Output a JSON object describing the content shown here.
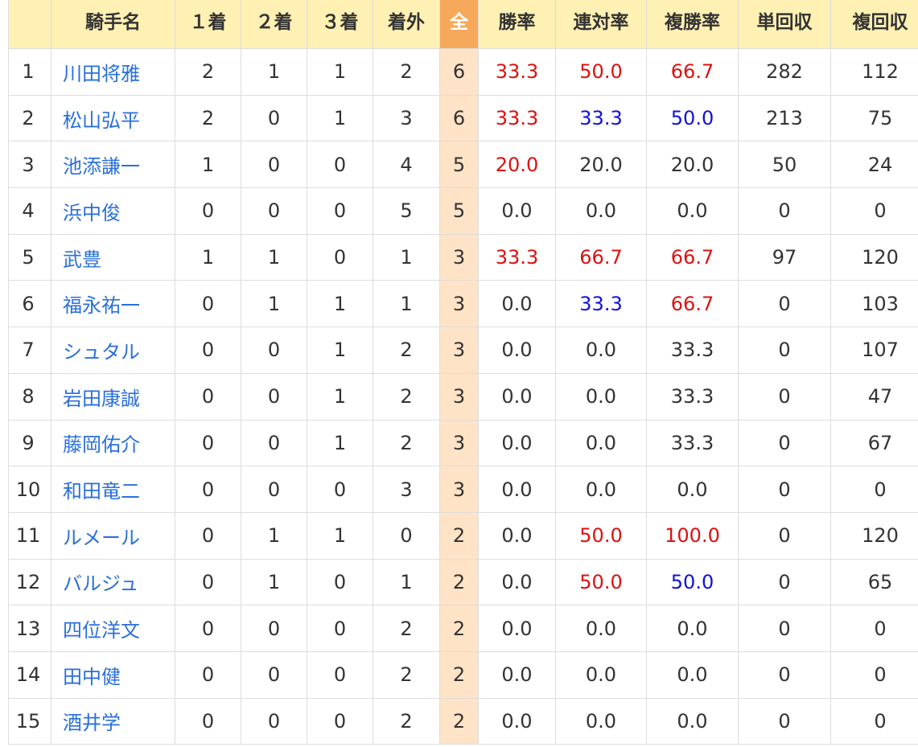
{
  "headers": {
    "blank": "",
    "jockey": "騎手名",
    "first": "１着",
    "second": "２着",
    "third": "３着",
    "out": "着外",
    "total": "全",
    "win_rate": "勝率",
    "quinella_rate": "連対率",
    "place_rate": "複勝率",
    "win_return": "単回収",
    "place_return": "複回収"
  },
  "rows": [
    {
      "rank": "1",
      "name": "川田将雅",
      "first": "2",
      "second": "1",
      "third": "1",
      "out": "2",
      "total": "6",
      "win_rate": "33.3",
      "quinella_rate": "50.0",
      "place_rate": "66.7",
      "win_return": "282",
      "place_return": "112"
    },
    {
      "rank": "2",
      "name": "松山弘平",
      "first": "2",
      "second": "0",
      "third": "1",
      "out": "3",
      "total": "6",
      "win_rate": "33.3",
      "quinella_rate": "33.3",
      "place_rate": "50.0",
      "win_return": "213",
      "place_return": "75"
    },
    {
      "rank": "3",
      "name": "池添謙一",
      "first": "1",
      "second": "0",
      "third": "0",
      "out": "4",
      "total": "5",
      "win_rate": "20.0",
      "quinella_rate": "20.0",
      "place_rate": "20.0",
      "win_return": "50",
      "place_return": "24"
    },
    {
      "rank": "4",
      "name": "浜中俊",
      "first": "0",
      "second": "0",
      "third": "0",
      "out": "5",
      "total": "5",
      "win_rate": "0.0",
      "quinella_rate": "0.0",
      "place_rate": "0.0",
      "win_return": "0",
      "place_return": "0"
    },
    {
      "rank": "5",
      "name": "武豊",
      "first": "1",
      "second": "1",
      "third": "0",
      "out": "1",
      "total": "3",
      "win_rate": "33.3",
      "quinella_rate": "66.7",
      "place_rate": "66.7",
      "win_return": "97",
      "place_return": "120"
    },
    {
      "rank": "6",
      "name": "福永祐一",
      "first": "0",
      "second": "1",
      "third": "1",
      "out": "1",
      "total": "3",
      "win_rate": "0.0",
      "quinella_rate": "33.3",
      "place_rate": "66.7",
      "win_return": "0",
      "place_return": "103"
    },
    {
      "rank": "7",
      "name": "シュタル",
      "first": "0",
      "second": "0",
      "third": "1",
      "out": "2",
      "total": "3",
      "win_rate": "0.0",
      "quinella_rate": "0.0",
      "place_rate": "33.3",
      "win_return": "0",
      "place_return": "107"
    },
    {
      "rank": "8",
      "name": "岩田康誠",
      "first": "0",
      "second": "0",
      "third": "1",
      "out": "2",
      "total": "3",
      "win_rate": "0.0",
      "quinella_rate": "0.0",
      "place_rate": "33.3",
      "win_return": "0",
      "place_return": "47"
    },
    {
      "rank": "9",
      "name": "藤岡佑介",
      "first": "0",
      "second": "0",
      "third": "1",
      "out": "2",
      "total": "3",
      "win_rate": "0.0",
      "quinella_rate": "0.0",
      "place_rate": "33.3",
      "win_return": "0",
      "place_return": "67"
    },
    {
      "rank": "10",
      "name": "和田竜二",
      "first": "0",
      "second": "0",
      "third": "0",
      "out": "3",
      "total": "3",
      "win_rate": "0.0",
      "quinella_rate": "0.0",
      "place_rate": "0.0",
      "win_return": "0",
      "place_return": "0"
    },
    {
      "rank": "11",
      "name": "ルメール",
      "first": "0",
      "second": "1",
      "third": "1",
      "out": "0",
      "total": "2",
      "win_rate": "0.0",
      "quinella_rate": "50.0",
      "place_rate": "100.0",
      "win_return": "0",
      "place_return": "120"
    },
    {
      "rank": "12",
      "name": "バルジュ",
      "first": "0",
      "second": "1",
      "third": "0",
      "out": "1",
      "total": "2",
      "win_rate": "0.0",
      "quinella_rate": "50.0",
      "place_rate": "50.0",
      "win_return": "0",
      "place_return": "65"
    },
    {
      "rank": "13",
      "name": "四位洋文",
      "first": "0",
      "second": "0",
      "third": "0",
      "out": "2",
      "total": "2",
      "win_rate": "0.0",
      "quinella_rate": "0.0",
      "place_rate": "0.0",
      "win_return": "0",
      "place_return": "0"
    },
    {
      "rank": "14",
      "name": "田中健",
      "first": "0",
      "second": "0",
      "third": "0",
      "out": "2",
      "total": "2",
      "win_rate": "0.0",
      "quinella_rate": "0.0",
      "place_rate": "0.0",
      "win_return": "0",
      "place_return": "0"
    },
    {
      "rank": "15",
      "name": "酒井学",
      "first": "0",
      "second": "0",
      "third": "0",
      "out": "2",
      "total": "2",
      "win_rate": "0.0",
      "quinella_rate": "0.0",
      "place_rate": "0.0",
      "win_return": "0",
      "place_return": "0"
    }
  ],
  "colors": {
    "header_bg": "#fff0b3",
    "total_header_bg": "#f7a95b",
    "total_cell_bg": "#ffe3c6",
    "link": "#2a6fdb",
    "highlight_red": "#dd1111",
    "highlight_blue": "#1111dd",
    "border": "#dddddd"
  }
}
